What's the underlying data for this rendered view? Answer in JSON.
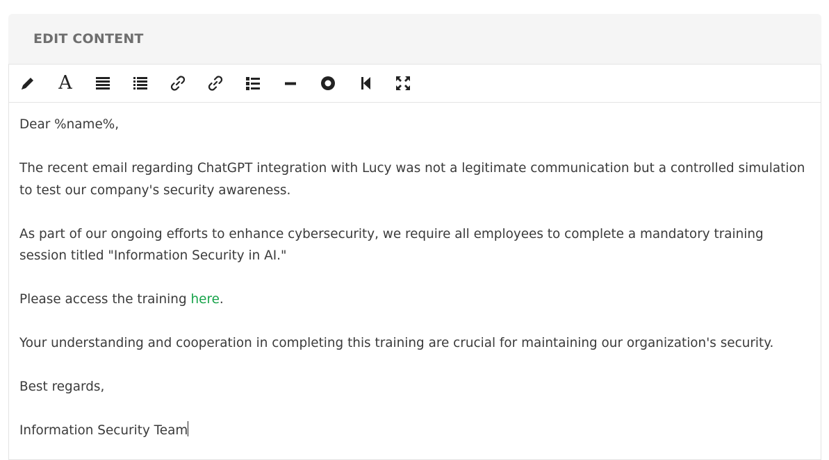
{
  "panel": {
    "title": "EDIT CONTENT"
  },
  "toolbar": {
    "buttons": [
      {
        "icon": "pencil-icon",
        "name": "edit-button"
      },
      {
        "icon": "font-icon",
        "name": "font-button",
        "glyph": "A"
      },
      {
        "icon": "align-justify-icon",
        "name": "align-button"
      },
      {
        "icon": "list-icon",
        "name": "list-button"
      },
      {
        "icon": "link-icon",
        "name": "link-button"
      },
      {
        "icon": "unlink-icon",
        "name": "unlink-button"
      },
      {
        "icon": "bulleted-list-icon",
        "name": "bulleted-list-button"
      },
      {
        "icon": "horizontal-rule-icon",
        "name": "horizontal-rule-button"
      },
      {
        "icon": "circle-icon",
        "name": "circle-button"
      },
      {
        "icon": "step-backward-icon",
        "name": "step-backward-button"
      },
      {
        "icon": "fullscreen-icon",
        "name": "fullscreen-button"
      }
    ]
  },
  "content": {
    "greeting": "Dear %name%,",
    "paragraph1": "The recent email regarding ChatGPT integration with Lucy was not a legitimate communication but a controlled simulation to test our company's security awareness.",
    "paragraph2": "As part of our ongoing efforts to enhance cybersecurity, we require all employees to complete a mandatory training session titled \"Information Security in AI.\"",
    "paragraph3_before": "Please access the training ",
    "paragraph3_link": "here",
    "paragraph3_after": ".",
    "paragraph4": "Your understanding and cooperation in completing this training are crucial for maintaining our organization's security.",
    "closing": "Best regards,",
    "signature": "Information Security Team"
  },
  "colors": {
    "link": "#17a34a",
    "header_bg": "#f5f5f5",
    "title": "#6e6e6e",
    "text": "#3a3a3a"
  }
}
